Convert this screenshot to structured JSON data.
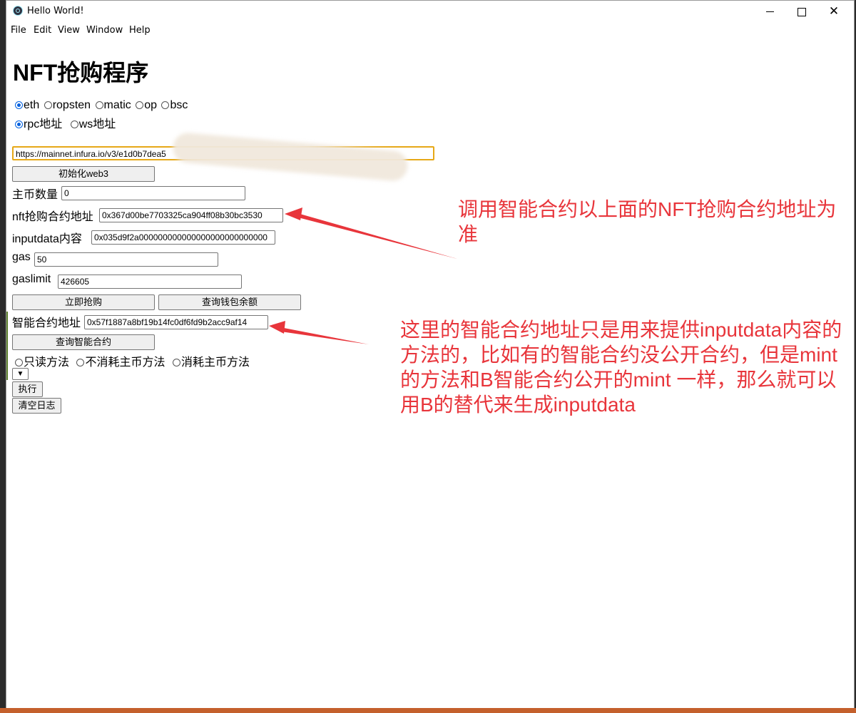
{
  "window": {
    "title": "Hello World!",
    "menu": [
      "File",
      "Edit",
      "View",
      "Window",
      "Help"
    ]
  },
  "page": {
    "title": "NFT抢购程序",
    "networks": [
      {
        "label": "eth",
        "checked": true
      },
      {
        "label": "ropsten",
        "checked": false
      },
      {
        "label": "matic",
        "checked": false
      },
      {
        "label": "op",
        "checked": false
      },
      {
        "label": "bsc",
        "checked": false
      }
    ],
    "conn_types": [
      {
        "label": "rpc地址",
        "checked": true
      },
      {
        "label": "ws地址",
        "checked": false
      }
    ],
    "rpc_url": "https://mainnet.infura.io/v3/e1d0b7dea5",
    "init_button": "初始化web3",
    "main_coin": {
      "label": "主币数量",
      "value": "0"
    },
    "nft_contract": {
      "label": "nft抢购合约地址",
      "value": "0x367d00be7703325ca904ff08b30bc3530"
    },
    "inputdata": {
      "label": "inputdata内容",
      "value": "0x035d9f2a000000000000000000000000000"
    },
    "gas": {
      "label": "gas",
      "value": "50"
    },
    "gaslimit": {
      "label": "gaslimit",
      "value": "426605"
    },
    "buy_button": "立即抢购",
    "balance_button": "查询钱包余额",
    "smart_contract": {
      "label": "智能合约地址",
      "value": "0x57f1887a8bf19b14fc0df6fd9b2acc9af14"
    },
    "query_contract_button": "查询智能合约",
    "method_types": [
      {
        "label": "只读方法",
        "checked": false
      },
      {
        "label": "不消耗主币方法",
        "checked": false
      },
      {
        "label": "消耗主币方法",
        "checked": false
      }
    ],
    "execute_button": "执行",
    "clear_log_button": "清空日志"
  },
  "annotations": {
    "note1": "调用智能合约以上面的NFT抢购合约地址为准",
    "note2": "这里的智能合约地址只是用来提供inputdata内容的方法的，比如有的智能合约没公开合约，但是mint的方法和B智能合约公开的mint 一样，那么就可以用B的替代来生成inputdata"
  },
  "colors": {
    "annotation": "#e8353b",
    "focus_border": "#e6a817",
    "radio_checked": "#0060df"
  }
}
